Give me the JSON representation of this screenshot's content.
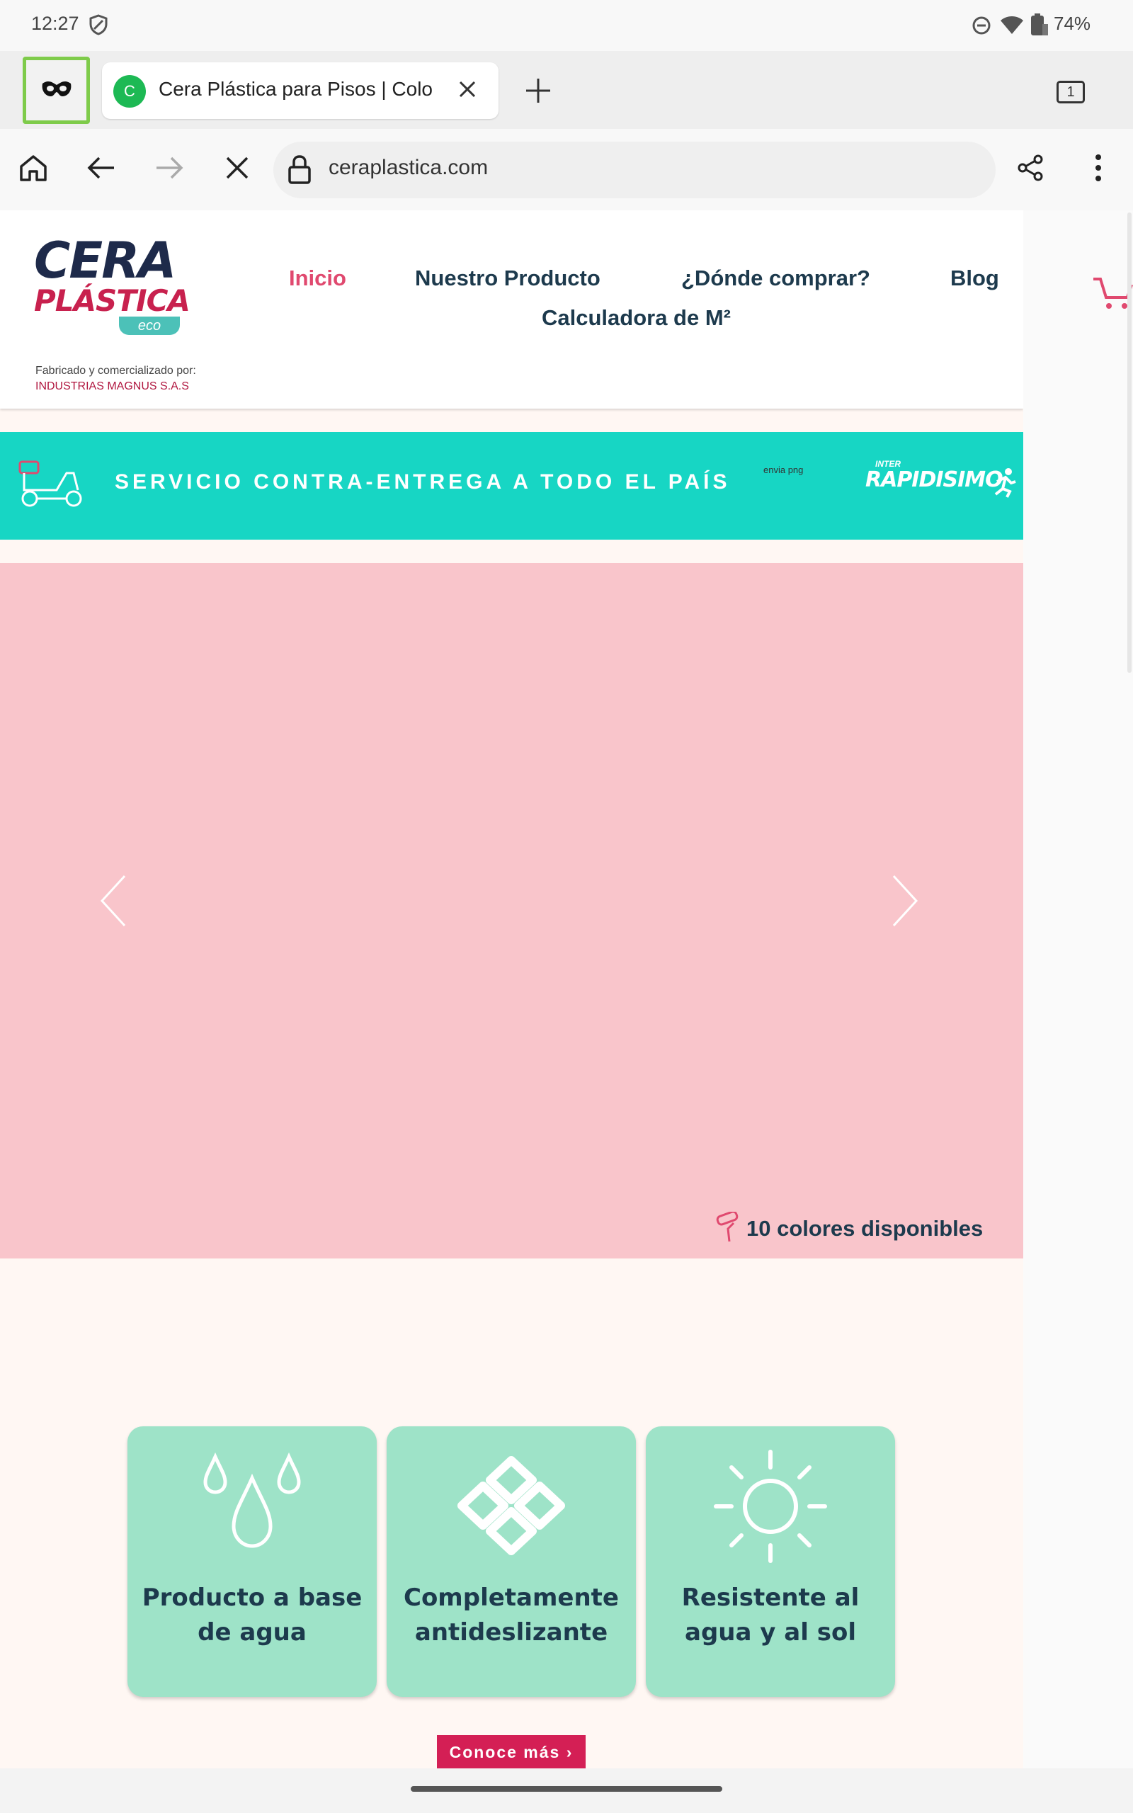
{
  "status_bar": {
    "time": "12:27",
    "battery": "74%",
    "icons": [
      "shield-icon",
      "dnd-icon",
      "wifi-icon",
      "battery-icon"
    ]
  },
  "tab_strip": {
    "incognito_icon": "incognito-mask-icon",
    "tab": {
      "favicon_letter": "C",
      "title": "Cera Plástica para Pisos | Colo"
    },
    "tab_count": "1"
  },
  "toolbar": {
    "url": "ceraplastica.com"
  },
  "site": {
    "logo": {
      "line1": "CERA",
      "line2": "PLÁSTICA",
      "badge": "eco"
    },
    "maker_label": "Fabricado y comercializado por:",
    "maker_name": "INDUSTRIAS MAGNUS S.A.S",
    "nav": {
      "inicio": "Inicio",
      "producto": "Nuestro Producto",
      "donde": "¿Dónde comprar?",
      "blog": "Blog",
      "calculadora": "Calculadora de M²"
    },
    "banner": {
      "text": "SERVICIO CONTRA-ENTREGA A TODO EL PAÍS",
      "envia_alt": "envia png",
      "inter_small": "INTER",
      "inter_logo": "RAPIDISIMO"
    },
    "hero": {
      "caption": "10 colores disponibles"
    },
    "features": [
      {
        "label": "Producto a base de agua",
        "icon": "water-drops-icon"
      },
      {
        "label": "Completamente antideslizante",
        "icon": "diamond-grid-icon"
      },
      {
        "label": "Resistente al agua y al sol",
        "icon": "sun-icon"
      }
    ],
    "cta": "Conoce más ›"
  },
  "colors": {
    "accent_pink": "#e0496f",
    "navy": "#1d3a4d",
    "teal": "#17d6c4",
    "mint": "#9ee3c8",
    "hero_pink": "#f9c5cb"
  }
}
